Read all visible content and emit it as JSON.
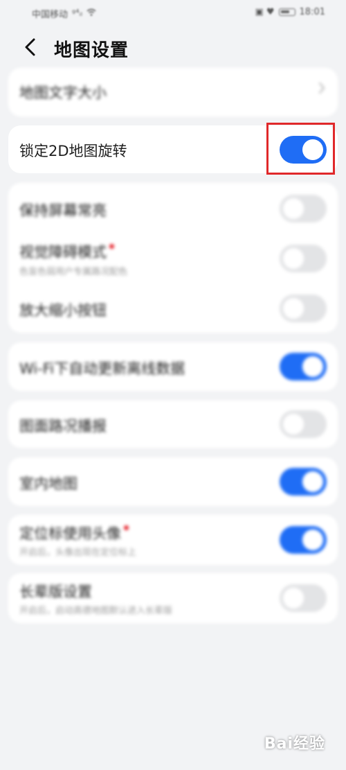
{
  "status_bar": {
    "carrier": "中国移动",
    "signal": "ᵍ⁴ᵢₗ",
    "wifi_icon": "wifi-icon",
    "right_icons": "▣ ♥",
    "time": "18:01"
  },
  "header": {
    "back_icon": "chevron-left-icon",
    "title": "地图设置"
  },
  "settings": {
    "map_text_size": {
      "label": "地图文字大小",
      "chevron": "›"
    },
    "lock_2d_rotation": {
      "label": "锁定2D地图旋转",
      "toggle": true
    },
    "keep_screen_on": {
      "label": "保持屏幕常亮",
      "toggle": false
    },
    "visual_impairment": {
      "label": "视觉障碍模式",
      "sub": "色盲色弱用户专属路况配色",
      "toggle": false,
      "new_dot": true
    },
    "zoom_buttons": {
      "label": "放大缩小按钮",
      "toggle": false
    },
    "wifi_offline_update": {
      "label": "Wi-Fi下自动更新离线数据",
      "toggle": true
    },
    "traffic_broadcast": {
      "label": "图面路况播报",
      "toggle": false
    },
    "indoor_map": {
      "label": "室内地图",
      "toggle": true
    },
    "avatar_locator": {
      "label": "定位标使用头像",
      "sub": "开启后，头像出现在定位标上",
      "toggle": true,
      "new_dot": true
    },
    "elderly_mode": {
      "label": "长辈版设置",
      "sub": "开启后，启动高德地图默认进入长辈版",
      "toggle": false
    }
  },
  "colors": {
    "accent": "#1f6df5",
    "toggle_off": "#e3e4e6",
    "highlight": "#e0282a",
    "background": "#f2f3f5"
  },
  "watermark": "Bai经验"
}
